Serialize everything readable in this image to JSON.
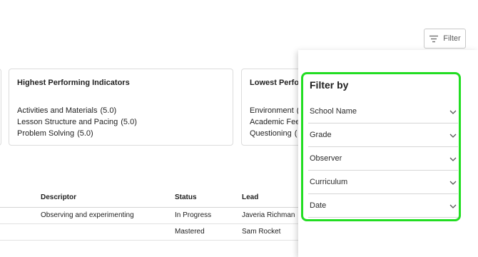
{
  "filter_button": {
    "label": "Filter",
    "icon": "filter-lines-icon"
  },
  "cards": {
    "highest": {
      "title": "Highest Performing Indicators",
      "items": [
        {
          "name": "Activities and Materials",
          "score": "(5.0)"
        },
        {
          "name": "Lesson Structure and Pacing",
          "score": "(5.0)"
        },
        {
          "name": "Problem Solving",
          "score": "(5.0)"
        }
      ]
    },
    "lowest": {
      "title": "Lowest Perfor",
      "items": [
        {
          "name": "Environment",
          "score": "("
        },
        {
          "name": "Academic Feed",
          "score": ""
        },
        {
          "name": "Questioning",
          "score": "("
        }
      ]
    }
  },
  "table": {
    "headers": {
      "descriptor": "Descriptor",
      "status": "Status",
      "lead": "Lead"
    },
    "rows": [
      {
        "descriptor": "Observing and experimenting",
        "status": "In Progress",
        "lead": "Javeria Richman"
      },
      {
        "descriptor": "",
        "status": "Mastered",
        "lead": "Sam Rocket"
      }
    ]
  },
  "filter_panel": {
    "title": "Filter by",
    "highlight_color": "#22dd22",
    "options": [
      {
        "label": "School Name",
        "icon": "chevron-down-icon"
      },
      {
        "label": "Grade",
        "icon": "chevron-down-icon"
      },
      {
        "label": "Observer",
        "icon": "chevron-down-icon"
      },
      {
        "label": "Curriculum",
        "icon": "chevron-down-icon"
      },
      {
        "label": "Date",
        "icon": "chevron-down-icon"
      }
    ]
  }
}
